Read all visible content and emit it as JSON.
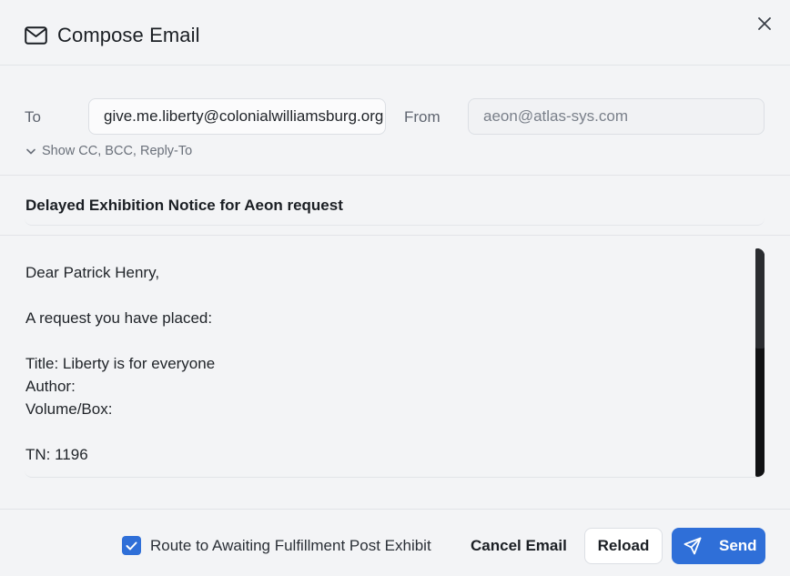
{
  "dialog": {
    "title": "Compose Email",
    "icon": "mail-icon",
    "close_icon": "close-icon"
  },
  "address": {
    "to_label": "To",
    "to_value": "give.me.liberty@colonialwilliamsburg.org",
    "from_label": "From",
    "from_value": "aeon@atlas-sys.com",
    "show_cc_label": "Show CC, BCC, Reply-To"
  },
  "subject": "Delayed Exhibition Notice for Aeon request",
  "body": {
    "lines": [
      "Dear Patrick Henry,",
      "",
      "A request you have placed:",
      "",
      "Title: Liberty is for everyone",
      "Author:",
      "Volume/Box:",
      "",
      "TN: 1196"
    ]
  },
  "footer": {
    "route_label": "Route to Awaiting Fulfillment Post Exhibit",
    "route_checked": true,
    "cancel_label": "Cancel Email",
    "reload_label": "Reload",
    "send_label": "Send"
  },
  "colors": {
    "accent": "#2f6fd8",
    "background": "#f3f4f6"
  }
}
